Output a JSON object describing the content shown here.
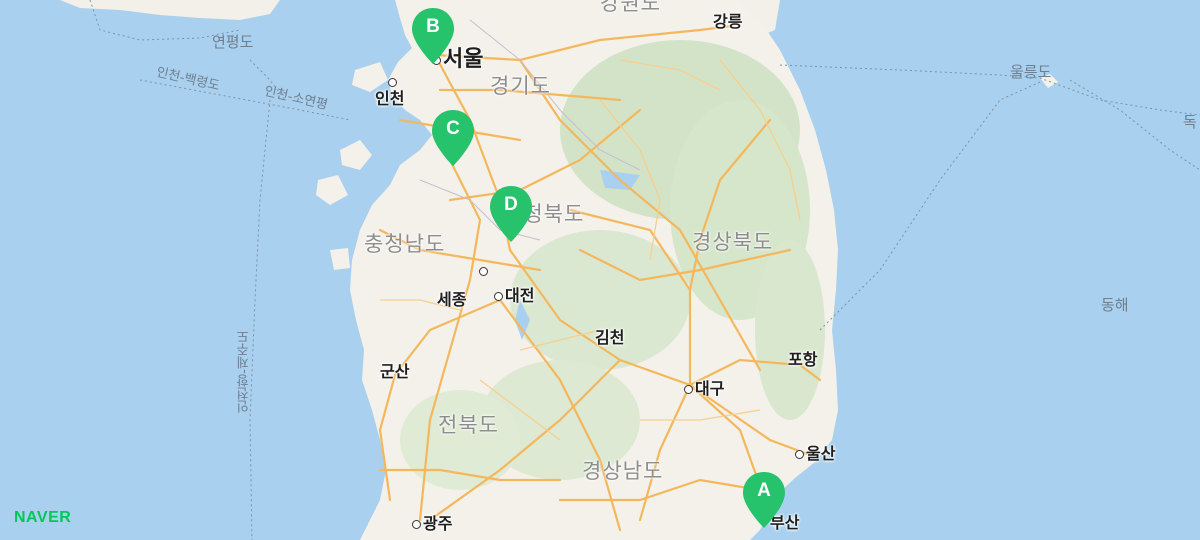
{
  "map": {
    "cities": {
      "seoul": "서울",
      "incheon": "인천",
      "gangneung": "강릉",
      "sejong": "세종",
      "daejeon": "대전",
      "gimcheon": "김천",
      "daegu": "대구",
      "pohang": "포항",
      "ulsan": "울산",
      "busan": "부산",
      "gunsan": "군산",
      "gwangju": "광주"
    },
    "provinces": {
      "gangwon": "강원도",
      "gyeonggi": "경기도",
      "chungbuk": "충청북도",
      "chungnam": "충청남도",
      "gyeongbuk": "경상북도",
      "jeonbuk": "전북도",
      "gyeongnam": "경상남도"
    },
    "sea": {
      "east_sea": "동해",
      "ulleungdo": "울릉도",
      "dokdo": "독",
      "yeonpyeongdo": "연평도"
    },
    "routes": {
      "baengnyeong": "인천-백령도",
      "soyeonpyeong": "인천-소연평",
      "jeju": "인천항-제주도"
    },
    "markers": [
      "A",
      "B",
      "C",
      "D"
    ],
    "colors": {
      "sea": "#a9d0ee",
      "land": "#f3f1ea",
      "forest": "#d7e5cd",
      "road": "#f4b75c",
      "marker": "#27c26c"
    }
  },
  "brand": {
    "logo": "NAVER"
  }
}
